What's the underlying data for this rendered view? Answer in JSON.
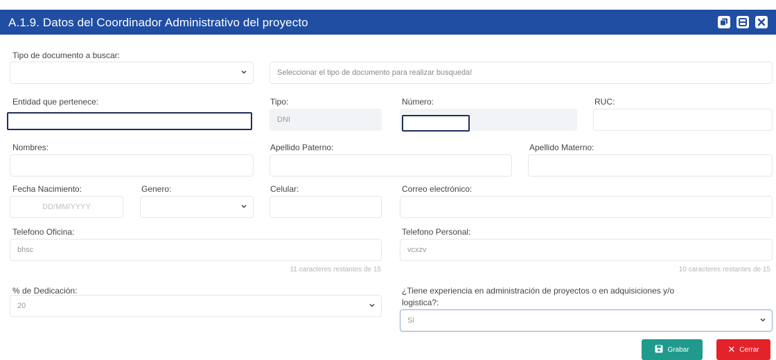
{
  "dialog": {
    "title": "A.1.9. Datos del Coordinador Administrativo del proyecto",
    "icons": [
      "copy-icon",
      "minimize-icon",
      "close-icon"
    ]
  },
  "doc_search": {
    "label": "Tipo de documento a buscar:",
    "select_value": "",
    "hint": "Seleccionar el tipo de documento para realizar busqueda!"
  },
  "entidad": {
    "label": "Entidad que pertenece:",
    "value": ""
  },
  "tipo": {
    "label": "Tipo:",
    "value": "DNI"
  },
  "numero": {
    "label": "Número:",
    "value": ""
  },
  "ruc": {
    "label": "RUC:",
    "value": ""
  },
  "nombres": {
    "label": "Nombres:",
    "value": ""
  },
  "apellido_paterno": {
    "label": "Apellido Paterno:",
    "value": ""
  },
  "apellido_materno": {
    "label": "Apellido Materno:",
    "value": ""
  },
  "fecha_nacimiento": {
    "label": "Fecha Nacimiento:",
    "placeholder": "DD/MM/YYYY"
  },
  "genero": {
    "label": "Genero:",
    "value": ""
  },
  "celular": {
    "label": "Celular:",
    "value": ""
  },
  "correo": {
    "label": "Correo electrónico:",
    "value": ""
  },
  "telefono_oficina": {
    "label": "Telefono Oficina:",
    "value": "bhsc",
    "helper": "11 caracteres restantes de 15"
  },
  "telefono_personal": {
    "label": "Telefono Personal:",
    "value": "vcxzv",
    "helper": "10 caracteres restantes de 15"
  },
  "dedicacion": {
    "label": "% de Dedicación:",
    "value": "20"
  },
  "experiencia": {
    "label_line1": "¿Tiene experiencia en administración de proyectos o en adquisiciones y/o",
    "label_line2": "logistica?:",
    "value": "Si"
  },
  "buttons": {
    "save": "Grabar",
    "close": "Cerrar"
  },
  "colors": {
    "header": "#1f4ea3",
    "save": "#1f9a8c",
    "close": "#e3222a"
  }
}
